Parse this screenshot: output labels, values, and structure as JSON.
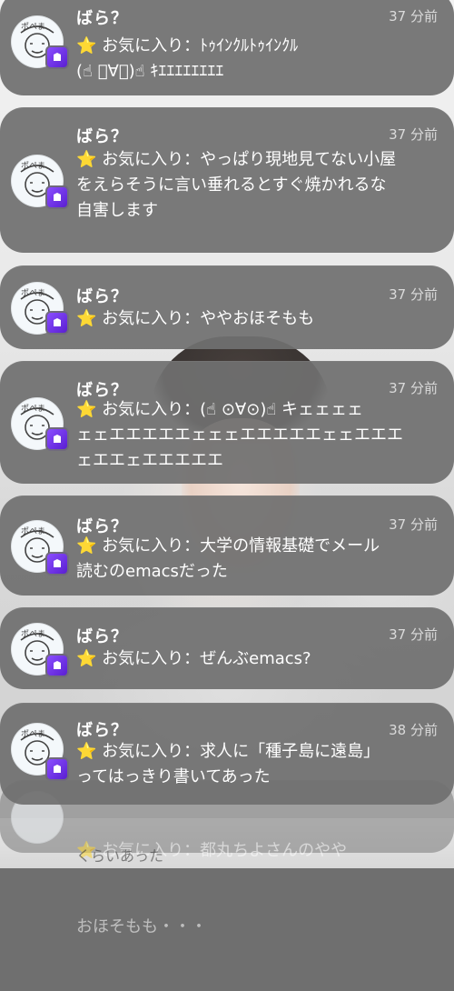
{
  "notifications": [
    {
      "sender": "ばら？",
      "time": "37 分前",
      "text": "⭐ お気に入り：ﾄｩｲﾝｸﾙﾄｩｲﾝｸﾙ\n(☝ ﾟ∀ﾟ)☝ ｷｴｴｴｴｴｴｴｴ"
    },
    {
      "sender": "ばら？",
      "time": "37 分前",
      "text": "⭐ お気に入り：やっぱり現地見てない小屋\nをえらそうに言い垂れるとすぐ焼かれるな\n自害します"
    },
    {
      "sender": "ばら？",
      "time": "37 分前",
      "text": "⭐ お気に入り：ややおほそもも"
    },
    {
      "sender": "ばら？",
      "time": "37 分前",
      "text": "⭐ お気に入り：(☝ ⊙∀⊙)☝ キェェェェ\nェェエエエエエェェェエエエエエェェエエエ\nェエエェエエエエエ"
    },
    {
      "sender": "ばら？",
      "time": "37 分前",
      "text": "⭐ お気に入り：大学の情報基礎でメール\n読むのemacsだった"
    },
    {
      "sender": "ばら？",
      "time": "37 分前",
      "text": "⭐ お気に入り：ぜんぶemacs?"
    },
    {
      "sender": "ばら？",
      "time": "38 分前",
      "text": "⭐ お気に入り：求人に「種子島に遠島」\nってはっきり書いてあった"
    }
  ],
  "partial": {
    "line1": "⭐ お気に入り：都丸ちよさんのやや",
    "line2": "おほそもも・・・",
    "line3": "くらいあった"
  },
  "colors": {
    "card": "#707070",
    "badge": "#7a3cf0",
    "star": "#ffcf2e"
  }
}
